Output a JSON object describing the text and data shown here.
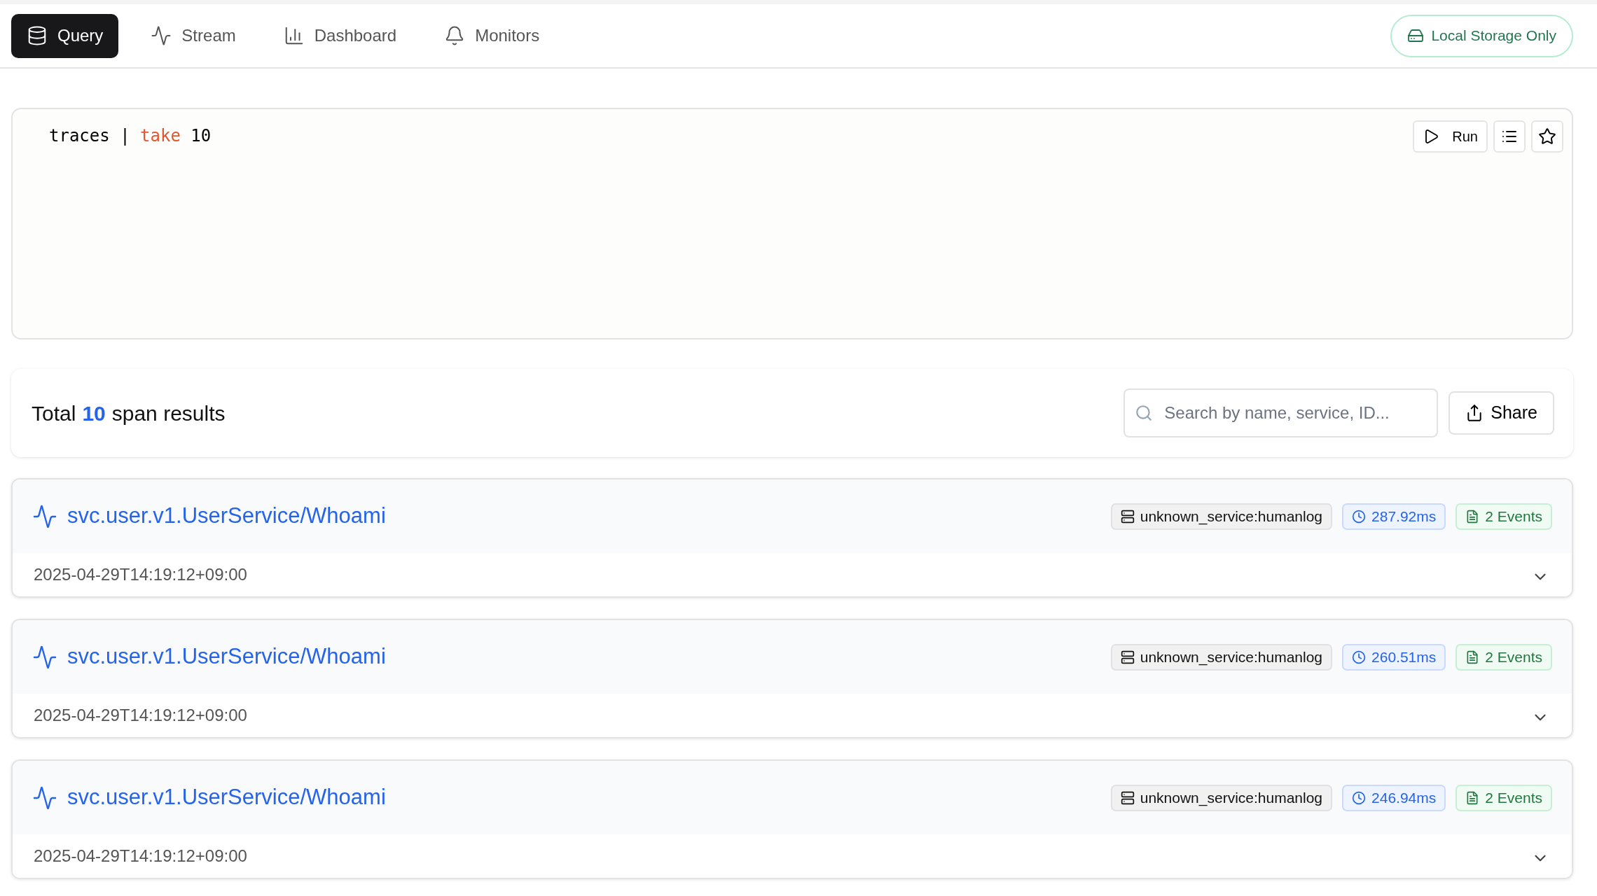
{
  "nav": {
    "tabs": [
      {
        "label": "Query",
        "kind": "database",
        "selected": true
      },
      {
        "label": "Stream",
        "kind": "activity",
        "selected": false
      },
      {
        "label": "Dashboard",
        "kind": "chart",
        "selected": false
      },
      {
        "label": "Monitors",
        "kind": "bell",
        "selected": false
      }
    ],
    "storage_badge": "Local Storage Only"
  },
  "editor": {
    "tokens": [
      {
        "text": "traces",
        "kind": "plain"
      },
      {
        "text": "|",
        "kind": "plain"
      },
      {
        "text": "take",
        "kind": "keyword"
      },
      {
        "text": "10",
        "kind": "plain"
      }
    ],
    "run_button": "Run"
  },
  "results": {
    "prefix": "Total",
    "count": "10",
    "suffix": "span results",
    "search": {
      "placeholder": "Search by name, service, ID..."
    },
    "share_button": "Share"
  },
  "spans": [
    {
      "name": "svc.user.v1.UserService/Whoami",
      "service": "unknown_service:humanlog",
      "duration": "287.92ms",
      "events": "2 Events",
      "timestamp": "2025-04-29T14:19:12+09:00"
    },
    {
      "name": "svc.user.v1.UserService/Whoami",
      "service": "unknown_service:humanlog",
      "duration": "260.51ms",
      "events": "2 Events",
      "timestamp": "2025-04-29T14:19:12+09:00"
    },
    {
      "name": "svc.user.v1.UserService/Whoami",
      "service": "unknown_service:humanlog",
      "duration": "246.94ms",
      "events": "2 Events",
      "timestamp": "2025-04-29T14:19:12+09:00"
    }
  ]
}
